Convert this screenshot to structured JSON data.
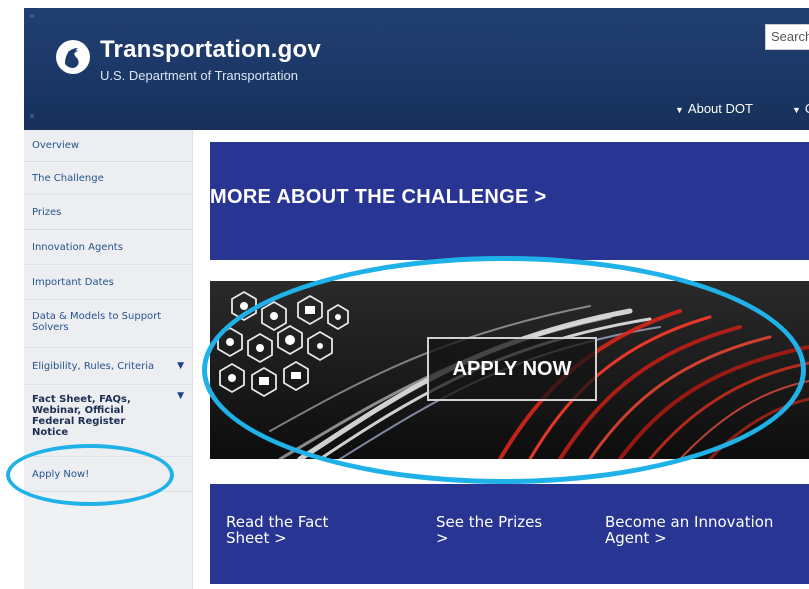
{
  "header": {
    "title": "Transportation.gov",
    "subtitle": "U.S. Department of Transportation",
    "search_placeholder": "Search",
    "nav": [
      {
        "label": "About DOT"
      },
      {
        "label": "O"
      }
    ]
  },
  "sidebar": {
    "items": [
      {
        "label": "Overview"
      },
      {
        "label": "The Challenge"
      },
      {
        "label": "Prizes"
      },
      {
        "label": "Innovation Agents"
      },
      {
        "label": "Important Dates"
      },
      {
        "label": "Data & Models to Support Solvers"
      },
      {
        "label": "Eligibility, Rules, Criteria"
      },
      {
        "label": "Fact Sheet, FAQs, Webinar, Official Federal Register Notice"
      },
      {
        "label": "Apply Now!"
      }
    ]
  },
  "main": {
    "challenge_heading": "MORE ABOUT THE CHALLENGE  >",
    "apply_button": "APPLY NOW",
    "ctas": [
      {
        "label": "Read the Fact Sheet  >"
      },
      {
        "label": "See the Prizes  >"
      },
      {
        "label": "Become an Innovation Agent  >"
      }
    ]
  },
  "colors": {
    "header_bg": "#1f3b6b",
    "panel_blue": "#283593",
    "sidebar_bg": "#eceef1",
    "link_blue": "#27548c",
    "annotation": "#1fb2e8"
  }
}
